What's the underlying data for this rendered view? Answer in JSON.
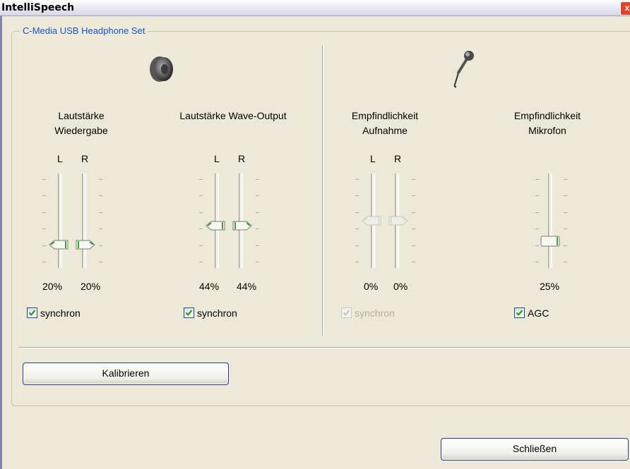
{
  "window": {
    "title": "IntelliSpeech",
    "close_glyph": "x"
  },
  "group": {
    "title": "C-Media USB Headphone Set"
  },
  "icons": {
    "speaker": "speaker-icon",
    "microphone": "microphone-icon"
  },
  "sliders": {
    "wiedergabe": {
      "label_line1": "Lautstärke",
      "label_line2": "Wiedergabe",
      "ch_left": "L",
      "ch_right": "R",
      "left_value": 20,
      "right_value": 20,
      "left_pct": "20%",
      "right_pct": "20%",
      "sync_label": "synchron",
      "sync_checked": true,
      "enabled": true
    },
    "wave": {
      "label_line1": "Lautstärke Wave-Output",
      "ch_left": "L",
      "ch_right": "R",
      "left_value": 44,
      "right_value": 44,
      "left_pct": "44%",
      "right_pct": "44%",
      "sync_label": "synchron",
      "sync_checked": true,
      "enabled": true
    },
    "aufnahme": {
      "label_line1": "Empfindlichkeit",
      "label_line2": "Aufnahme",
      "ch_left": "L",
      "ch_right": "R",
      "left_value": 0,
      "right_value": 0,
      "left_pct": "0%",
      "right_pct": "0%",
      "sync_label": "synchron",
      "sync_checked": true,
      "enabled": false
    },
    "mikrofon": {
      "label_line1": "Empfindlichkeit",
      "label_line2": "Mikrofon",
      "value": 25,
      "pct": "25%",
      "agc_label": "AGC",
      "agc_checked": true,
      "enabled": true
    }
  },
  "buttons": {
    "calibrate": "Kalibrieren",
    "close": "Schließen"
  },
  "colors": {
    "accent_green": "#3aa63a",
    "group_title": "#1a52cc",
    "button_border": "#1b3c8a"
  }
}
